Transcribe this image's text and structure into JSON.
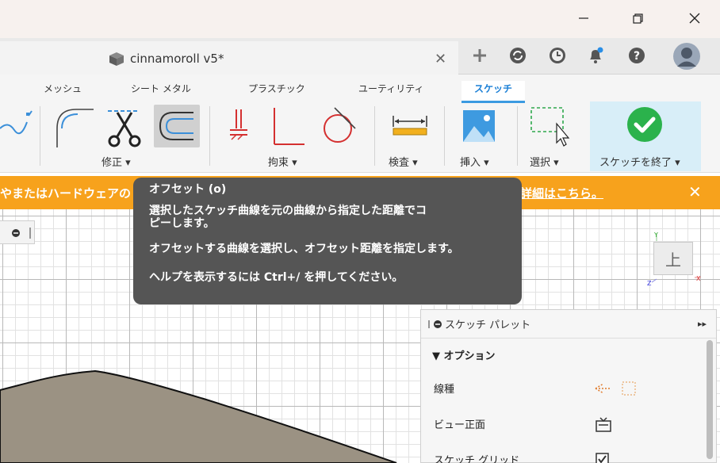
{
  "window": {
    "minimize_label": "—",
    "restore_label": "❐",
    "close_label": "✕"
  },
  "document_tab": {
    "title": "cinnamoroll v5*",
    "close_label": "✕"
  },
  "tabbar_icons": [
    "plus-icon",
    "cloud-sync-icon",
    "clock-icon",
    "notification-bell-icon",
    "help-icon",
    "avatar"
  ],
  "workspace_tabs": [
    {
      "label": "メッシュ"
    },
    {
      "label": "シート メタル"
    },
    {
      "label": "プラスチック"
    },
    {
      "label": "ユーティリティ"
    },
    {
      "label": "スケッチ",
      "active": true
    }
  ],
  "tool_groups": {
    "modify": "修正 ▾",
    "constraints": "拘束 ▾",
    "inspect": "検査 ▾",
    "insert": "挿入 ▾",
    "select": "選択 ▾",
    "finish": "スケッチを終了 ▾"
  },
  "warning": {
    "text": "やまたはハードウェアの",
    "link": "詳細はこちら。",
    "close_label": "✕"
  },
  "tooltip": {
    "title": "オフセット (o)",
    "line1": "選択したスケッチ曲線を元の曲線から指定した距離でコ",
    "line2": "ピーします。",
    "line3": "オフセットする曲線を選択し、オフセット距離を指定します。",
    "line4": "ヘルプを表示するには Ctrl+/ を押してください。"
  },
  "viewcube": {
    "face_label": "上",
    "axis_y": "Y",
    "axis_x": "X",
    "axis_z": "Z"
  },
  "palette": {
    "title": "スケッチ パレット",
    "expand_label": "▸▸",
    "options_header": "▼ オプション",
    "rows": [
      {
        "label": "線種"
      },
      {
        "label": "ビュー正面"
      },
      {
        "label": "スケッチ グリッド"
      }
    ]
  },
  "colors": {
    "warning_bar": "#f7a21c",
    "tooltip_bg": "#555555",
    "active_tab": "#1a7fd6",
    "finish_check": "#2bb24c",
    "sketch_fill": "#9b9283"
  }
}
